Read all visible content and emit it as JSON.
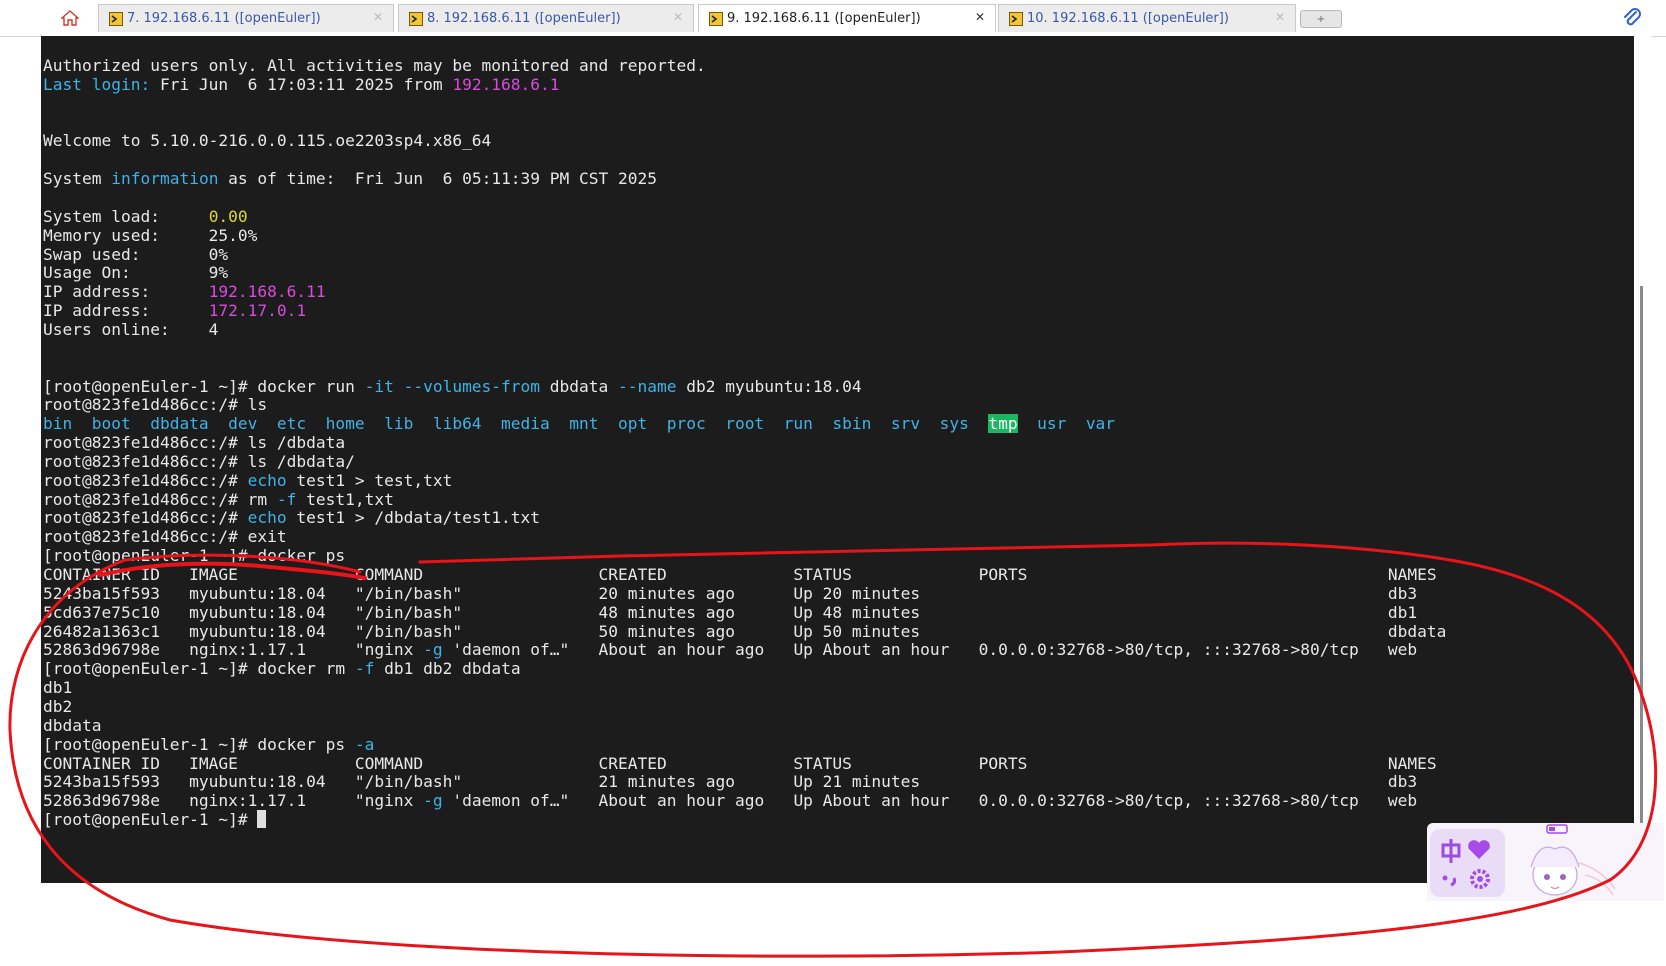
{
  "tabs": [
    {
      "label": "7. 192.168.6.11 ([openEuler])",
      "active": false
    },
    {
      "label": "8. 192.168.6.11 ([openEuler])",
      "active": false
    },
    {
      "label": "9. 192.168.6.11 ([openEuler])",
      "active": true
    },
    {
      "label": "10. 192.168.6.11 ([openEuler])",
      "active": false
    }
  ],
  "new_tab_label": "+",
  "colors": {
    "terminal_bg": "#1c1c1c",
    "text": "#e8e8e8",
    "cyan": "#3fb2e6",
    "magenta": "#d84bdc",
    "yellow": "#e0d33b",
    "green_highlight": "#19b75f",
    "annotation_red": "#e8141a"
  },
  "terminal": {
    "lines": [
      [
        {
          "t": "Authorized users only. All activities may be monitored and reported."
        }
      ],
      [
        {
          "t": "Last login:",
          "c": "cyan"
        },
        {
          "t": " Fri Jun  6 17:03:11 2025 from "
        },
        {
          "t": "192.168.6.1",
          "c": "magenta"
        }
      ],
      [],
      [],
      [
        {
          "t": "Welcome to 5.10.0-216.0.0.115.oe2203sp4.x86_64"
        }
      ],
      [],
      [
        {
          "t": "System "
        },
        {
          "t": "information",
          "c": "cyan"
        },
        {
          "t": " as of time:  Fri Jun  6 05:11:39 PM CST 2025"
        }
      ],
      [],
      [
        {
          "t": "System load:     "
        },
        {
          "t": "0.00",
          "c": "yellow"
        }
      ],
      [
        {
          "t": "Memory used:     25.0%"
        }
      ],
      [
        {
          "t": "Swap used:       0%"
        }
      ],
      [
        {
          "t": "Usage On:        9%"
        }
      ],
      [
        {
          "t": "IP address:      "
        },
        {
          "t": "192.168.6.11",
          "c": "magenta"
        }
      ],
      [
        {
          "t": "IP address:      "
        },
        {
          "t": "172.17.0.1",
          "c": "magenta"
        }
      ],
      [
        {
          "t": "Users online:    4"
        }
      ],
      [],
      [],
      [
        {
          "t": "[root@openEuler-1 ~]# docker run "
        },
        {
          "t": "-it --volumes-from",
          "c": "cyan"
        },
        {
          "t": " dbdata "
        },
        {
          "t": "--name",
          "c": "cyan"
        },
        {
          "t": " db2 myubuntu:18.04"
        }
      ],
      [
        {
          "t": "root@823fe1d486cc:/# ls"
        }
      ],
      [
        {
          "t": "bin  boot  dbdata  dev  etc  home  lib  lib64  media  mnt  opt  proc  root  run  sbin  srv  sys  ",
          "c": "cyan"
        },
        {
          "t": "tmp",
          "c": "hl"
        },
        {
          "t": "  usr  var",
          "c": "cyan"
        }
      ],
      [
        {
          "t": "root@823fe1d486cc:/# ls /dbdata"
        }
      ],
      [
        {
          "t": "root@823fe1d486cc:/# ls /dbdata/"
        }
      ],
      [
        {
          "t": "root@823fe1d486cc:/# "
        },
        {
          "t": "echo",
          "c": "cyan"
        },
        {
          "t": " test1 > test,txt"
        }
      ],
      [
        {
          "t": "root@823fe1d486cc:/# rm "
        },
        {
          "t": "-f",
          "c": "cyan"
        },
        {
          "t": " test1,txt"
        }
      ],
      [
        {
          "t": "root@823fe1d486cc:/# "
        },
        {
          "t": "echo",
          "c": "cyan"
        },
        {
          "t": " test1 > /dbdata/test1.txt"
        }
      ],
      [
        {
          "t": "root@823fe1d486cc:/# exit"
        }
      ],
      [
        {
          "t": "[root@openEuler-1 ~]# docker ps"
        }
      ],
      [
        {
          "t": "CONTAINER ID   IMAGE            COMMAND                  CREATED             STATUS             PORTS                                     NAMES"
        }
      ],
      [
        {
          "t": "5243ba15f593   myubuntu:18.04   \"/bin/bash\"              20 minutes ago      Up 20 minutes                                                db3"
        }
      ],
      [
        {
          "t": "5cd637e75c10   myubuntu:18.04   \"/bin/bash\"              48 minutes ago      Up 48 minutes                                                db1"
        }
      ],
      [
        {
          "t": "26482a1363c1   myubuntu:18.04   \"/bin/bash\"              50 minutes ago      Up 50 minutes                                                dbdata"
        }
      ],
      [
        {
          "t": "52863d96798e   nginx:1.17.1     \"nginx "
        },
        {
          "t": "-g",
          "c": "cyan"
        },
        {
          "t": " 'daemon of…\"   About an hour ago   Up About an hour   0.0.0.0:32768->80/tcp, :::32768->80/tcp   web"
        }
      ],
      [
        {
          "t": "[root@openEuler-1 ~]# docker rm "
        },
        {
          "t": "-f",
          "c": "cyan"
        },
        {
          "t": " db1 db2 dbdata"
        }
      ],
      [
        {
          "t": "db1"
        }
      ],
      [
        {
          "t": "db2"
        }
      ],
      [
        {
          "t": "dbdata"
        }
      ],
      [
        {
          "t": "[root@openEuler-1 ~]# docker ps "
        },
        {
          "t": "-a",
          "c": "cyan"
        }
      ],
      [
        {
          "t": "CONTAINER ID   IMAGE            COMMAND                  CREATED             STATUS             PORTS                                     NAMES"
        }
      ],
      [
        {
          "t": "5243ba15f593   myubuntu:18.04   \"/bin/bash\"              21 minutes ago      Up 21 minutes                                                db3"
        }
      ],
      [
        {
          "t": "52863d96798e   nginx:1.17.1     \"nginx "
        },
        {
          "t": "-g",
          "c": "cyan"
        },
        {
          "t": " 'daemon of…\"   About an hour ago   Up About an hour   0.0.0.0:32768->80/tcp, :::32768->80/tcp   web"
        }
      ],
      [
        {
          "t": "[root@openEuler-1 ~]# "
        },
        {
          "t": "",
          "c": "cursor"
        }
      ]
    ]
  },
  "widget": {
    "icons": [
      "chinese-input-icon",
      "heart-icon",
      "punctuation-icon",
      "settings-icon",
      "mascot-image",
      "battery-icon"
    ]
  }
}
